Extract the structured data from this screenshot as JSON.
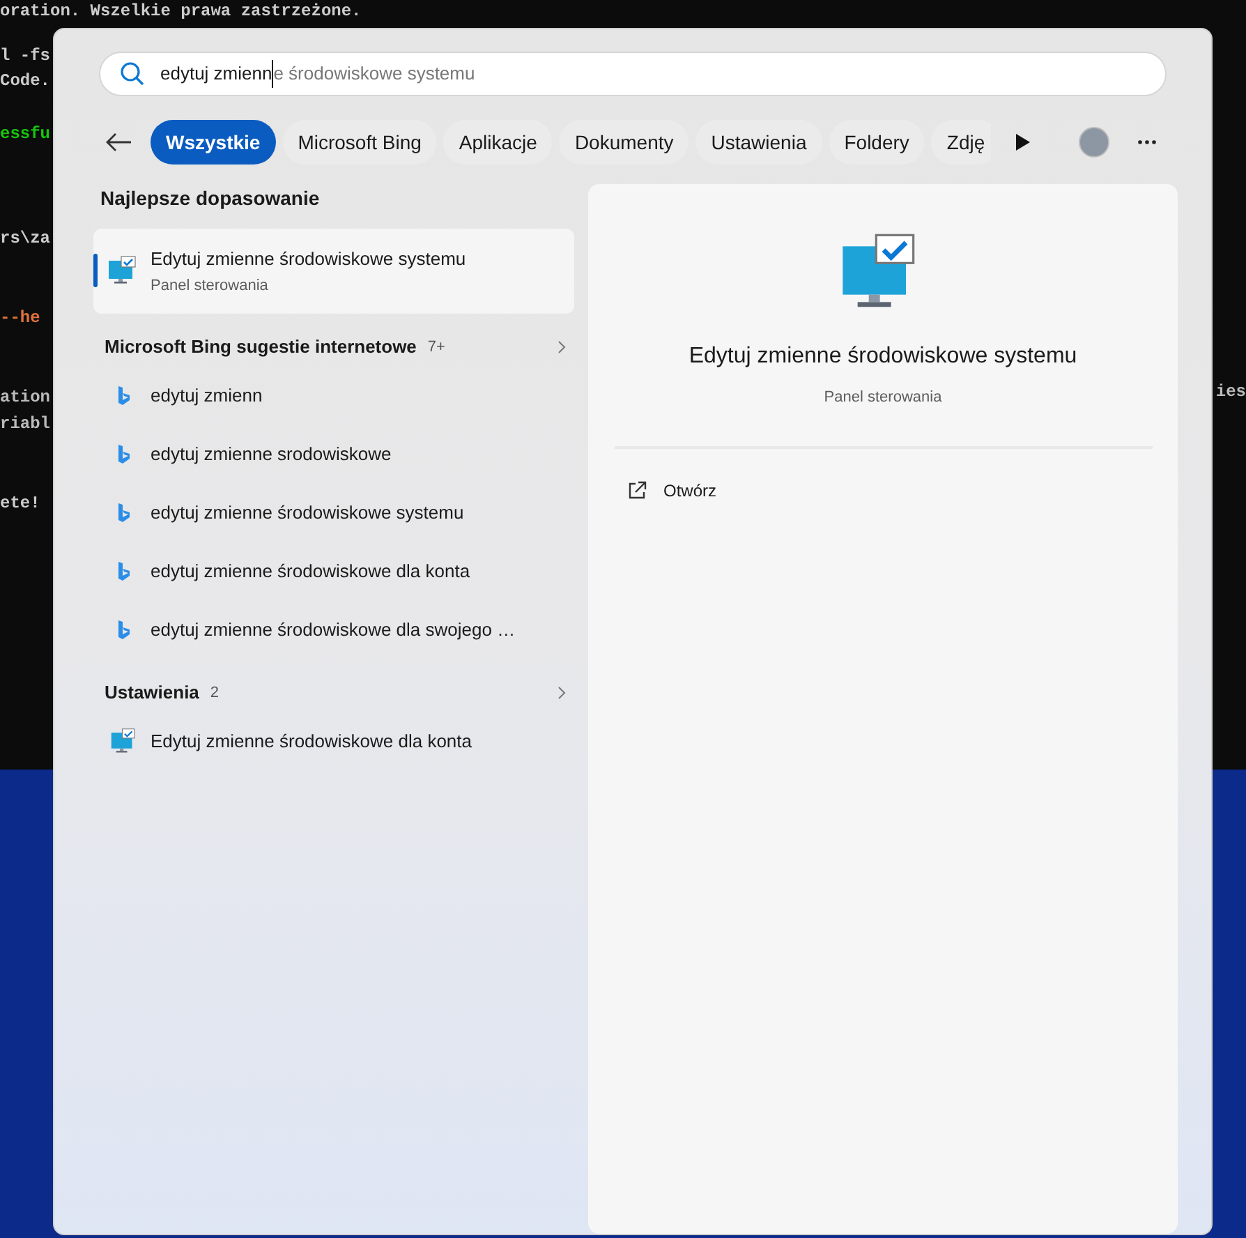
{
  "terminal": {
    "lines": [
      {
        "text": "oration. Wszelkie prawa zastrzeżone.",
        "kind": "plain"
      },
      {
        "text": "l -fs",
        "kind": "plain"
      },
      {
        "text": "Code.",
        "kind": "plain"
      },
      {
        "text": "essfu",
        "kind": "success"
      },
      {
        "text": "rs\\za",
        "kind": "plain"
      },
      {
        "text": "--he",
        "kind": "flag"
      },
      {
        "text": "ation",
        "kind": "dim"
      },
      {
        "text": "riabl",
        "kind": "dim"
      },
      {
        "text": "ete!",
        "kind": "plain"
      }
    ],
    "right_fragment": "ies"
  },
  "search": {
    "value": "edytuj zmienn",
    "completion": "e środowiskowe systemu"
  },
  "filters": [
    {
      "label": "Wszystkie",
      "selected": true
    },
    {
      "label": "Microsoft Bing",
      "selected": false
    },
    {
      "label": "Aplikacje",
      "selected": false
    },
    {
      "label": "Dokumenty",
      "selected": false
    },
    {
      "label": "Ustawienia",
      "selected": false
    },
    {
      "label": "Foldery",
      "selected": false
    },
    {
      "label": "Zdję",
      "selected": false
    }
  ],
  "best_match": {
    "heading": "Najlepsze dopasowanie",
    "title": "Edytuj zmienne środowiskowe systemu",
    "subtitle": "Panel sterowania",
    "selected": true
  },
  "sections": [
    {
      "title": "Microsoft Bing sugestie internetowe",
      "count": "7+",
      "kind": "web",
      "items": [
        "edytuj zmienn",
        "edytuj zmienne srodowiskowe",
        "edytuj zmienne środowiskowe systemu",
        "edytuj zmienne środowiskowe dla konta",
        "edytuj zmienne środowiskowe dla swojego …"
      ]
    },
    {
      "title": "Ustawienia",
      "count": "2",
      "kind": "settings",
      "items": [
        "Edytuj zmienne środowiskowe dla konta"
      ]
    }
  ],
  "preview": {
    "title": "Edytuj zmienne środowiskowe systemu",
    "subtitle": "Panel sterowania",
    "actions": [
      "Otwórz"
    ]
  }
}
